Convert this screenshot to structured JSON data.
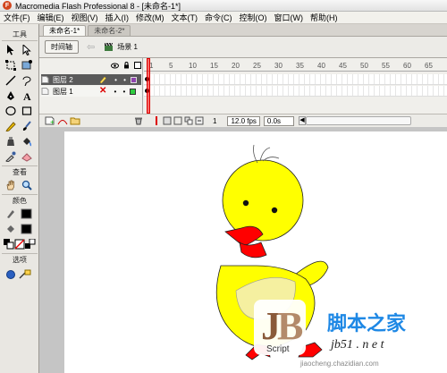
{
  "window": {
    "title": "Macromedia Flash Professional 8 - [未命名-1*]",
    "logo_glyph": "F"
  },
  "menu": [
    "文件(F)",
    "编辑(E)",
    "视图(V)",
    "插入(I)",
    "修改(M)",
    "文本(T)",
    "命令(C)",
    "控制(O)",
    "窗口(W)",
    "帮助(H)"
  ],
  "toolbox": {
    "header_tools": "工具",
    "header_view": "查看",
    "header_colors": "颜色",
    "header_options": "选项"
  },
  "doc_tabs": [
    "未命名-1*",
    "未命名-2*"
  ],
  "editbar": {
    "timeline_button": "时间轴",
    "scene": "场景 1"
  },
  "timeline": {
    "layers": [
      {
        "name": "图层 2",
        "selected": true
      },
      {
        "name": "图层 1",
        "selected": false
      }
    ],
    "ruler": [
      "1",
      "5",
      "10",
      "15",
      "20",
      "25",
      "30",
      "35",
      "40",
      "45",
      "50",
      "55",
      "60",
      "65"
    ],
    "current_frame": "1",
    "fps": "12.0 fps",
    "time": "0.0s"
  },
  "colors": {
    "duck_body": "#ffff00",
    "duck_beak": "#ff0000",
    "wing": "#f5f0a0",
    "accent": "#5a5a5a"
  },
  "watermark": {
    "brand": "脚本之家",
    "script": "Script",
    "url": "jiaocheng.chazidian.com",
    "sub": "jb51 . n e t"
  }
}
